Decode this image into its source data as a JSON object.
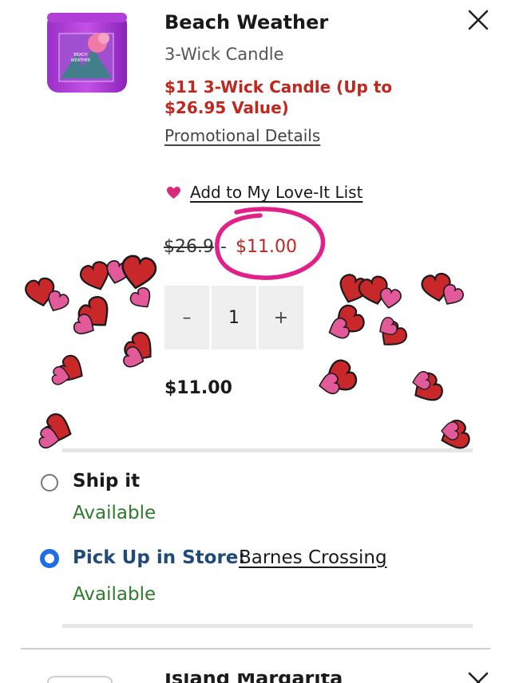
{
  "item": {
    "name": "Beach Weather",
    "variant": "3-Wick Candle",
    "promo": "$11 3-Wick Candle (Up to $26.95 Value)",
    "promo_link": "Promotional Details",
    "jar_label_line1": "BEACH",
    "jar_label_line2": "WEATHER",
    "love_it": "Add to My Love-It List",
    "price_original": "$26.9",
    "price_separator": "-",
    "price_sale": "$11.00",
    "qty_minus": "–",
    "qty_value": "1",
    "qty_plus": "+",
    "line_total": "$11.00"
  },
  "fulfillment": {
    "ship_label": "Ship it",
    "ship_status": "Available",
    "ship_selected": false,
    "pickup_label": "Pick Up in Store:",
    "pickup_store": "Barnes Crossing",
    "pickup_status": "Available",
    "pickup_selected": true
  },
  "next_item": {
    "name_partial": "Island Margarita"
  },
  "colors": {
    "sale_red": "#c0271e",
    "available_green": "#2f7a2c",
    "radio_blue": "#1f6fe0",
    "heart_magenta": "#d8297c",
    "circle_pink": "#e2208a"
  },
  "icons": {
    "close": "close-icon",
    "heart": "heart-icon"
  }
}
